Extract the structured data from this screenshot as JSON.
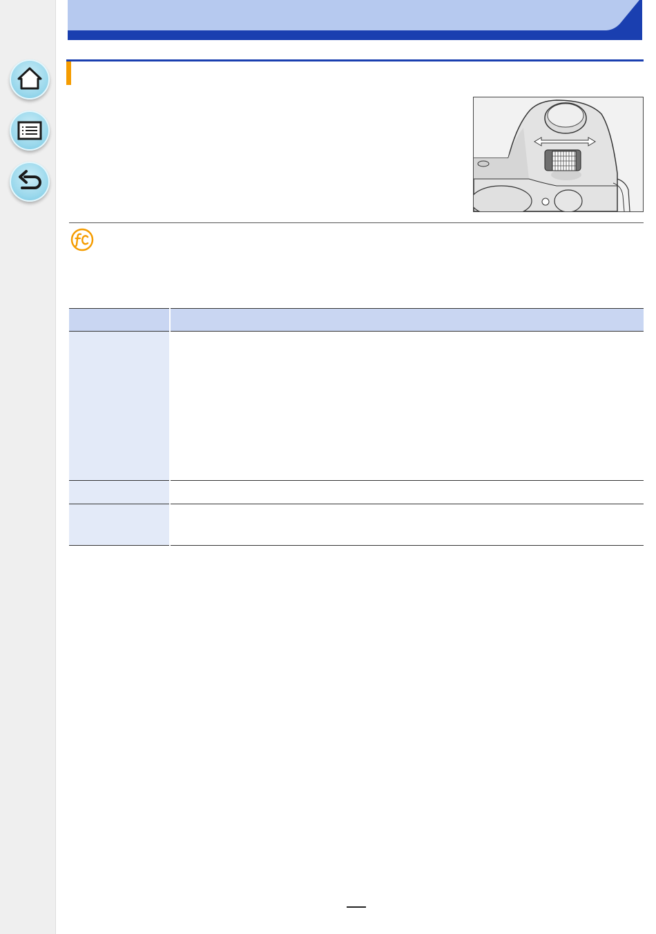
{
  "colors": {
    "header_light": "#b6c9ef",
    "header_dark": "#1a3fb0",
    "accent_orange": "#f59c00",
    "nav_button": "#9ad8ec",
    "table_header": "#c9d6f2",
    "table_label_cell": "#e3eaf8"
  },
  "navigation": {
    "home_icon": "home-icon",
    "menu_icon": "menu-list-icon",
    "back_icon": "return-arrow-icon"
  },
  "illustration": {
    "subject": "camera-top-rear-dial",
    "badge_icon": "custom-function-fc-icon"
  },
  "table": {
    "rows": 3
  }
}
